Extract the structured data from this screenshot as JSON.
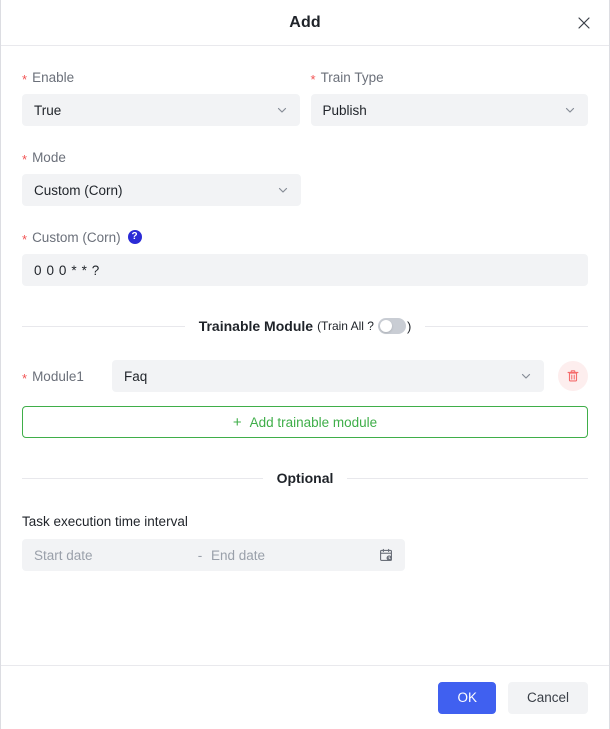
{
  "dialog": {
    "title": "Add",
    "close_icon": "close-icon"
  },
  "fields": {
    "enable": {
      "label": "Enable",
      "required_marker": "*",
      "value": "True"
    },
    "train_type": {
      "label": "Train Type",
      "required_marker": "*",
      "value": "Publish"
    },
    "mode": {
      "label": "Mode",
      "required_marker": "*",
      "value": "Custom (Corn)"
    },
    "custom_corn": {
      "label": "Custom (Corn)",
      "required_marker": "*",
      "help_icon": "?",
      "value": "0 0 0 * * ?"
    }
  },
  "trainable_module": {
    "divider_title": "Trainable Module",
    "train_all_label": "(Train All ?",
    "train_all_close_paren": ")",
    "train_all_enabled": false,
    "modules": [
      {
        "label": "Module1",
        "required_marker": "*",
        "value": "Faq",
        "delete_icon": "trash-icon"
      }
    ],
    "add_button": {
      "plus": "+",
      "label": "Add trainable module"
    }
  },
  "optional": {
    "divider_title": "Optional",
    "time_interval_label": "Task execution time interval",
    "date_range": {
      "start_placeholder": "Start date",
      "separator": "-",
      "end_placeholder": "End date",
      "calendar_icon": "calendar-clock-icon"
    }
  },
  "footer": {
    "ok_label": "OK",
    "cancel_label": "Cancel"
  },
  "colors": {
    "primary": "#4060f0",
    "required": "#f25454",
    "help": "#2b2bd6",
    "add_green": "#3fae49",
    "delete_red": "#f56c6c",
    "field_bg": "#f2f3f5"
  }
}
